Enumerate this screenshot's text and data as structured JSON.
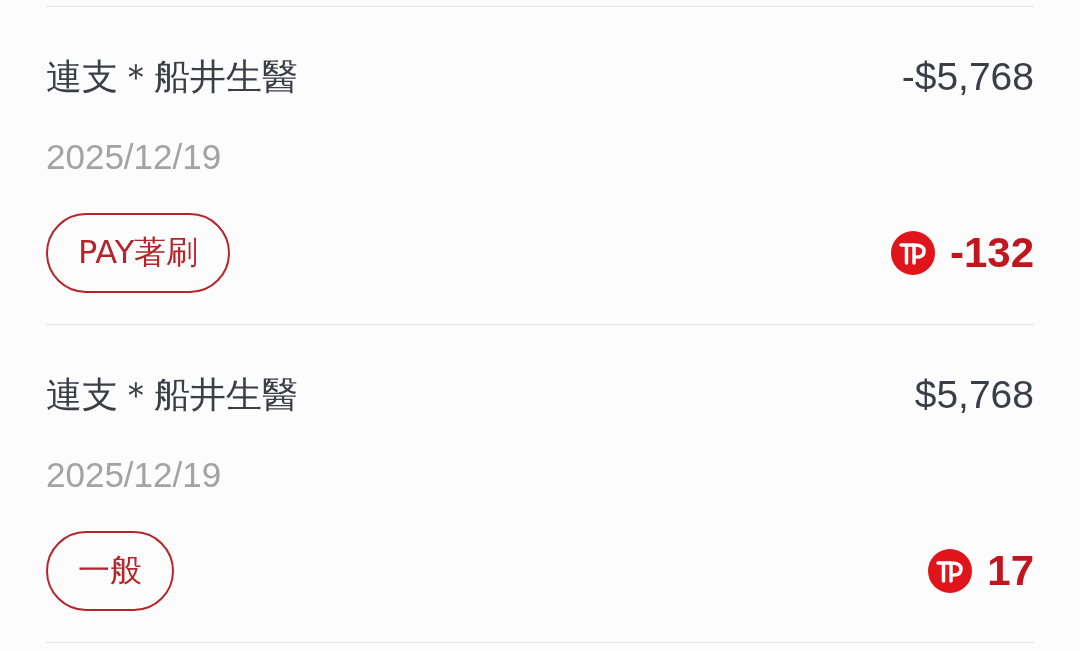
{
  "transactions": [
    {
      "merchant": "連支＊船井生醫",
      "amount": "-$5,768",
      "date": "2025/12/19",
      "tag": "PAY著刷",
      "points": "-132"
    },
    {
      "merchant": "連支＊船井生醫",
      "amount": "$5,768",
      "date": "2025/12/19",
      "tag": "一般",
      "points": "17"
    }
  ]
}
